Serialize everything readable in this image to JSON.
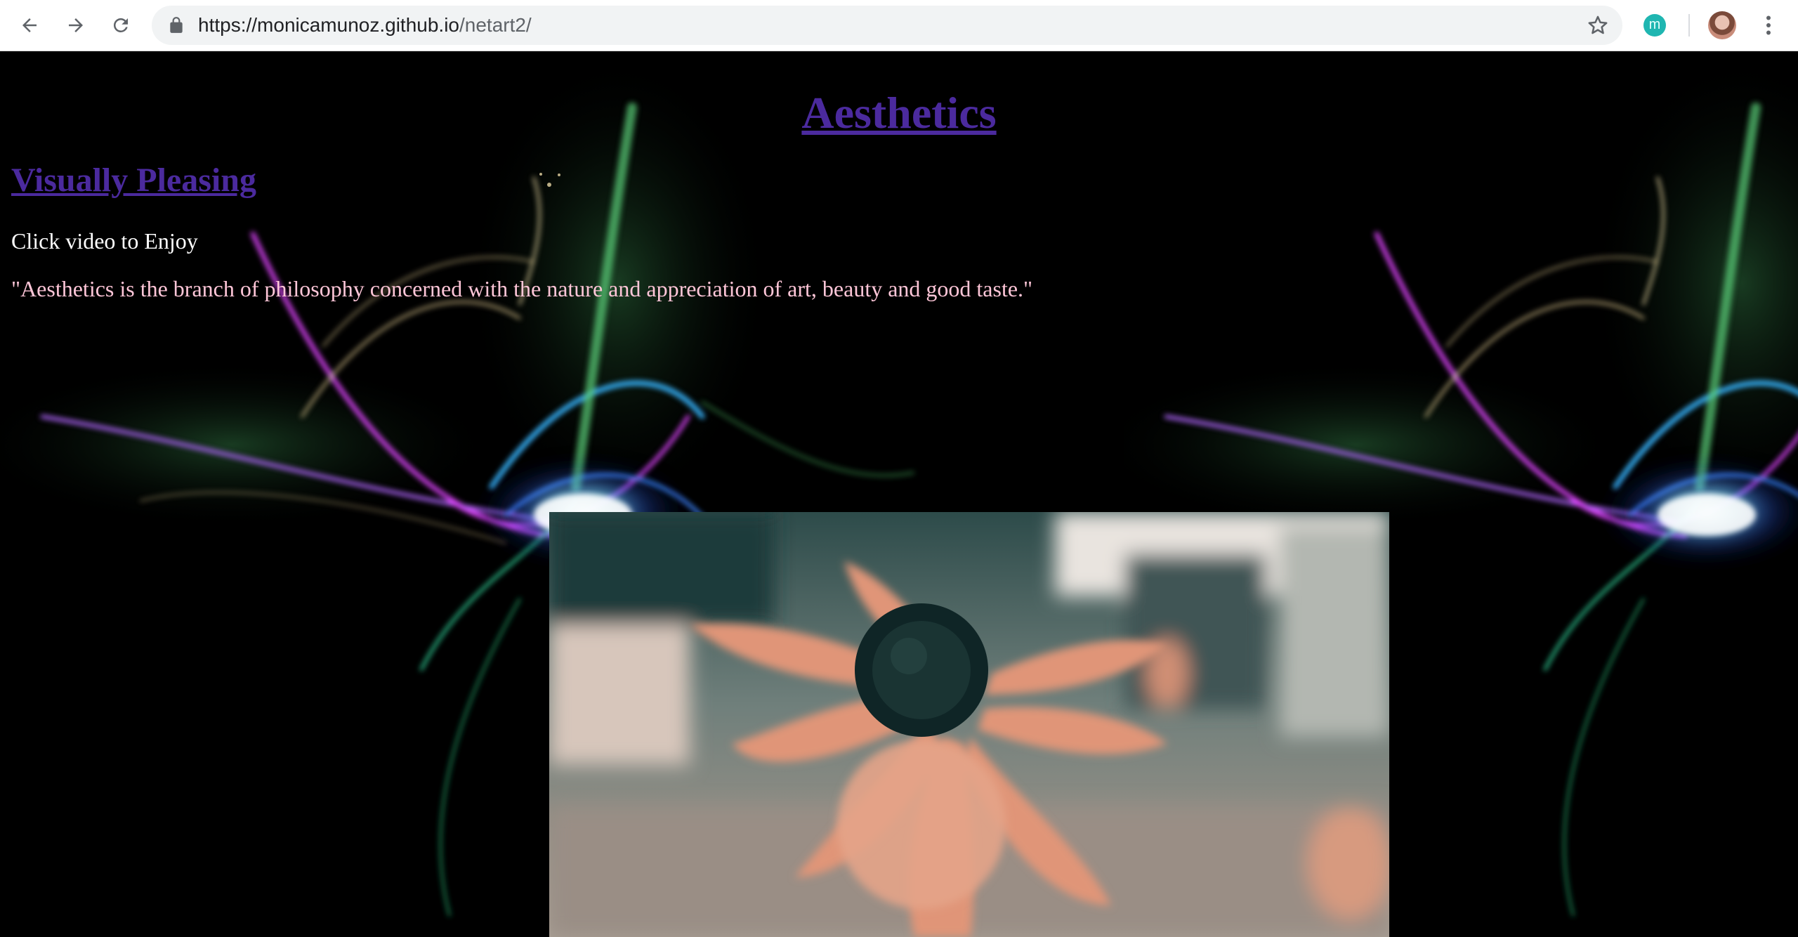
{
  "browser": {
    "url_host": "https://monicamunoz.github.io",
    "url_path": "/netart2/",
    "extension_letter": "m"
  },
  "page": {
    "title": "Aesthetics",
    "section_title": "Visually Pleasing",
    "instructions": "Click video to Enjoy",
    "quote": "\"Aesthetics is the branch of philosophy concerned with the nature and appreciation of art, beauty and good taste.\""
  },
  "colors": {
    "link": "#4b2a9e",
    "quote": "#ffc6d8",
    "text": "#ffffff",
    "background": "#000000"
  },
  "icons": [
    "back-icon",
    "forward-icon",
    "reload-icon",
    "lock-icon",
    "star-icon",
    "extension-icon",
    "avatar",
    "more-menu-icon"
  ]
}
